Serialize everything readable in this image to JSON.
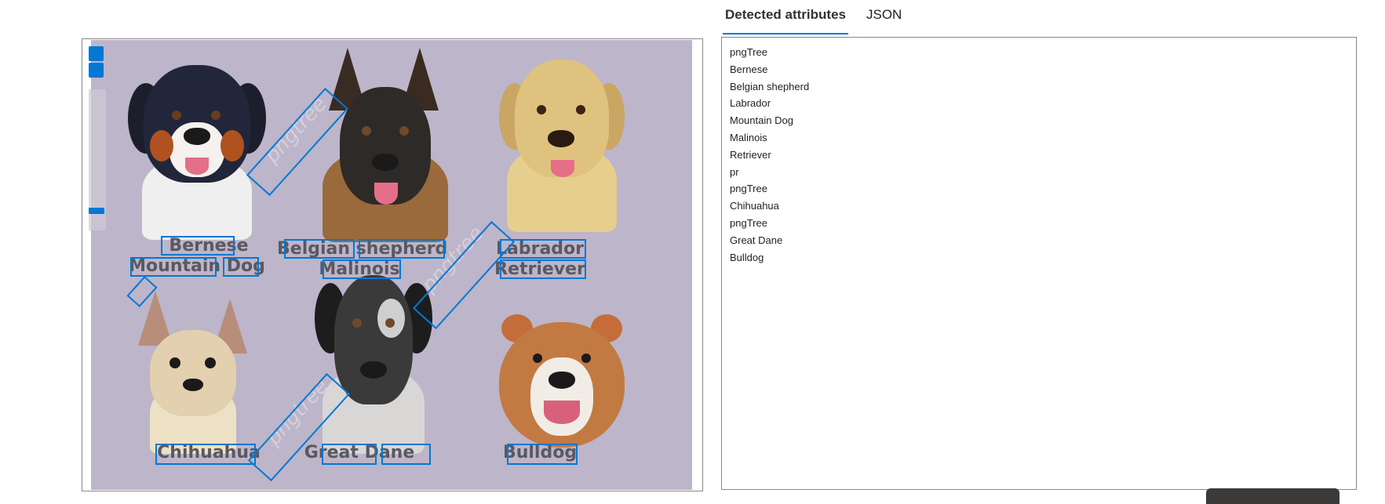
{
  "tabs": {
    "detected": "Detected attributes",
    "json": "JSON"
  },
  "image": {
    "captions": {
      "bernese_1": "Bernese",
      "bernese_2": "Mountain Dog",
      "belgian_1": "Belgian shepherd",
      "belgian_2": "Malinois",
      "labrador_1": "Labrador",
      "labrador_2": "Retriever",
      "chihuahua": "Chihuahua",
      "great_dane": "Great Dane",
      "bulldog": "Bulldog"
    },
    "watermark_text": "pngtree",
    "dogs": [
      "bernese-mountain-dog",
      "belgian-shepherd-malinois",
      "labrador-retriever",
      "chihuahua",
      "great-dane",
      "bulldog"
    ],
    "colors": {
      "background": "#bdb5c9",
      "bbox": "#0078d4",
      "caption": "#5a5860"
    }
  },
  "zoom_controls": {
    "icons": [
      "zoom-in-icon",
      "zoom-out-icon"
    ]
  },
  "attributes": [
    "pngTree",
    "Bernese",
    "Belgian shepherd",
    "Labrador",
    "Mountain Dog",
    "Malinois",
    "Retriever",
    "pr",
    "pngTree",
    "Chihuahua",
    "pngTree",
    "Great Dane",
    "Bulldog"
  ],
  "colors": {
    "accent": "#0078d4",
    "text": "#201f1e",
    "border": "#8a8886"
  }
}
